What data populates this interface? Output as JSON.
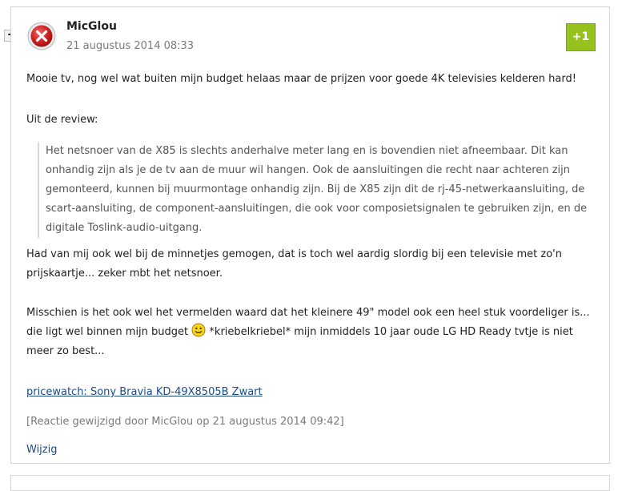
{
  "collapse_label": "-",
  "comment": {
    "username": "MicGlou",
    "timestamp": "21 augustus 2014 08:33",
    "vote_label": "+1",
    "paragraph1": "Mooie tv, nog wel wat buiten mijn budget helaas maar de prijzen voor goede 4K televisies kelderen hard!",
    "paragraph2": "Uit de review:",
    "quote": "Het netsnoer van de X85 is slechts anderhalve meter lang en is bovendien niet afneembaar. Dit kan onhandig zijn als je de tv aan de muur wil hangen. Ook de aansluitingen die recht naar achteren zijn gemonteerd, kunnen bij muurmontage onhandig zijn. Bij de X85 zijn dit de rj-45-netwerkaansluiting, de scart-aansluiting, de component-aansluitingen, die ook voor composietsignalen te gebruiken zijn, en de digitale Toslink-audio-uitgang.",
    "paragraph3": "Had van mij ook wel bij de minnetjes gemogen, dat is toch wel aardig slordig bij een televisie met zo'n prijskaartje... zeker mbt het netsnoer.",
    "paragraph4_before": "Misschien is het ook wel het vermelden waard dat het kleinere 49\" model ook een heel stuk voordeliger is... die ligt wel binnen mijn budget ",
    "paragraph4_after": " *kriebelkriebel* mijn inmiddels 10 jaar oude LG HD Ready tvtje is niet meer zo best...",
    "pricewatch_link": "pricewatch: Sony Bravia KD-49X8505B Zwart",
    "edited_note": "[Reactie gewijzigd door MicGlou op 21 augustus 2014 09:42]",
    "edit_link": "Wijzig"
  },
  "icons": {
    "avatar": "red-x-error-icon",
    "smiley": "smiley-icon"
  },
  "colors": {
    "vote_button": "#96c11f",
    "link": "#1a4a8c",
    "muted": "#7a7a7a"
  }
}
